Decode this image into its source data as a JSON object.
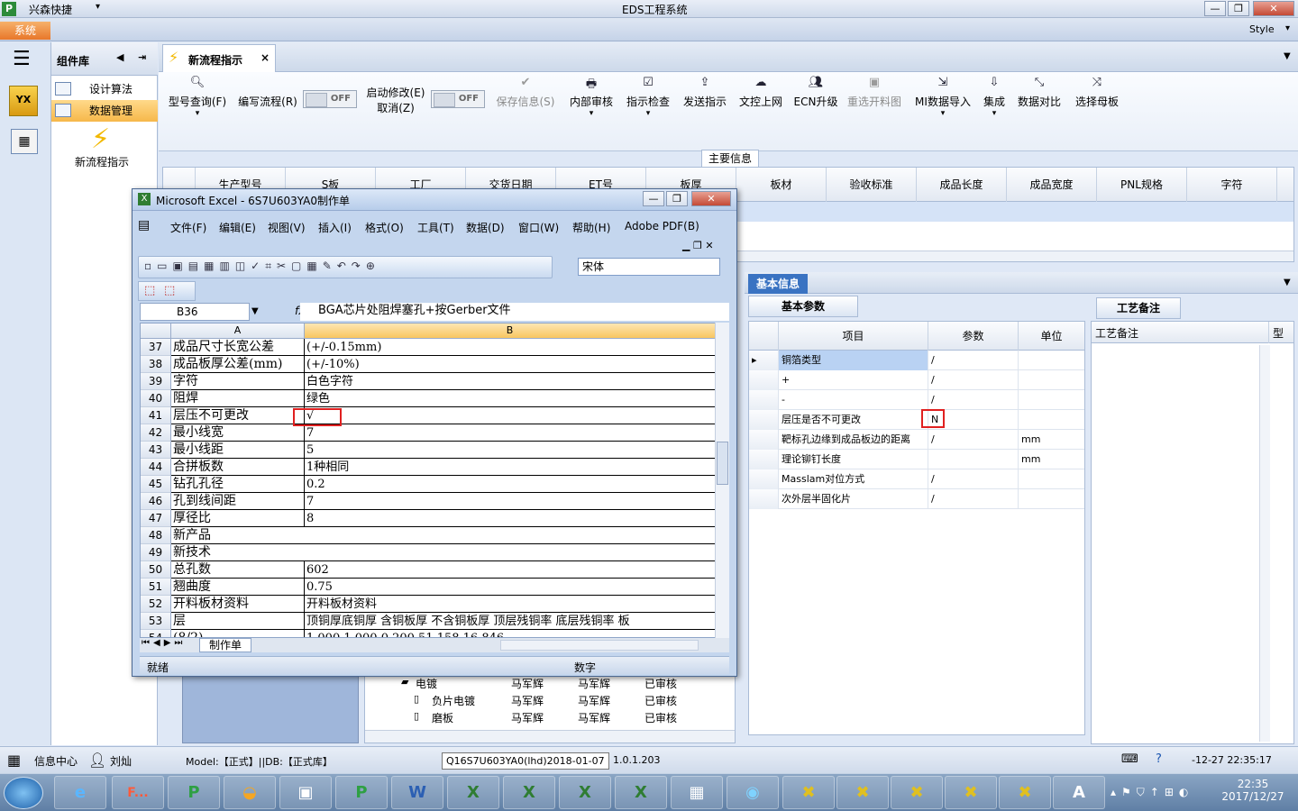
{
  "app": {
    "brand": "兴森快捷",
    "window_title": "EDS工程系统",
    "style_label": "Style",
    "system_tab": "系统"
  },
  "components": {
    "title": "组件库",
    "items": [
      {
        "label": "设计算法"
      },
      {
        "label": "数据管理"
      }
    ],
    "new_flow_label": "新流程指示"
  },
  "doc_tab": {
    "label": "新流程指示",
    "close": "×"
  },
  "toolbar": {
    "model_query": "型号查询(F)",
    "write_flow": "编写流程(R)",
    "toggle_off": "OFF",
    "start_modify": "启动修改(E)",
    "cancel": "取消(Z)",
    "save_info": "保存信息(S)",
    "internal_review": "内部审核",
    "instruction_check": "指示检查",
    "send_instruction": "发送指示",
    "upload": "文控上网",
    "ecn_upgrade": "ECN升级",
    "reselect_image": "重选开料图",
    "mi_import": "MI数据导入",
    "integrate": "集成",
    "data_compare": "数据对比",
    "select_mother": "选择母板"
  },
  "main_info": {
    "label": "主要信息",
    "columns": [
      "生产型号",
      "S板",
      "工厂",
      "交货日期",
      "ET号",
      "板厚",
      "板材",
      "验收标准",
      "成品长度",
      "成品宽度",
      "PNL规格",
      "字符"
    ]
  },
  "basic_info": {
    "label": "基本信息",
    "params_tab": "基本参数",
    "columns": [
      "项目",
      "参数",
      "单位"
    ],
    "rows": [
      {
        "item": "铜箔类型",
        "param": "/",
        "unit": ""
      },
      {
        "item": "+",
        "param": "/",
        "unit": ""
      },
      {
        "item": "-",
        "param": "/",
        "unit": ""
      },
      {
        "item": "层压是否不可更改",
        "param": "N",
        "unit": ""
      },
      {
        "item": "靶标孔边缘到成品板边的距离",
        "param": "/",
        "unit": "mm"
      },
      {
        "item": "理论铆钉长度",
        "param": "",
        "unit": "mm"
      },
      {
        "item": "Masslam对位方式",
        "param": "/",
        "unit": ""
      },
      {
        "item": "次外层半固化片",
        "param": "/",
        "unit": ""
      }
    ]
  },
  "craft_notes": {
    "tab": "工艺备注",
    "col1": "工艺备注",
    "col2": "型"
  },
  "tree": {
    "rows": [
      {
        "name": "电镀",
        "a": "马军辉",
        "b": "马军辉",
        "s": "已审核"
      },
      {
        "name": "负片电镀",
        "a": "马军辉",
        "b": "马军辉",
        "s": "已审核"
      },
      {
        "name": "磨板",
        "a": "马军辉",
        "b": "马军辉",
        "s": "已审核"
      }
    ]
  },
  "excel": {
    "title": "Microsoft Excel - 6S7U603YA0制作单",
    "menus": [
      "文件(F)",
      "编辑(E)",
      "视图(V)",
      "插入(I)",
      "格式(O)",
      "工具(T)",
      "数据(D)",
      "窗口(W)",
      "帮助(H)",
      "Adobe PDF(B)"
    ],
    "font": "宋体",
    "cell_ref": "B36",
    "formula": "BGA芯片处阻焊塞孔+按Gerber文件",
    "col_a": "A",
    "col_b": "B",
    "rows": [
      {
        "n": "37",
        "a": "成品尺寸长宽公差",
        "b": "(+/-0.15mm)"
      },
      {
        "n": "38",
        "a": "成品板厚公差(mm)",
        "b": "(+/-10%)"
      },
      {
        "n": "39",
        "a": "字符",
        "b": "白色字符"
      },
      {
        "n": "40",
        "a": "阻焊",
        "b": "绿色"
      },
      {
        "n": "41",
        "a": "层压不可更改",
        "b": "√"
      },
      {
        "n": "42",
        "a": "最小线宽",
        "b": "7"
      },
      {
        "n": "43",
        "a": "最小线距",
        "b": "5"
      },
      {
        "n": "44",
        "a": "合拼板数",
        "b": "1种相同"
      },
      {
        "n": "45",
        "a": "钻孔孔径",
        "b": "0.2"
      },
      {
        "n": "46",
        "a": "孔到线间距",
        "b": "7"
      },
      {
        "n": "47",
        "a": "厚径比",
        "b": "8"
      },
      {
        "n": "48",
        "a": "新产品",
        "b": ""
      },
      {
        "n": "49",
        "a": "新技术",
        "b": ""
      },
      {
        "n": "50",
        "a": "总孔数",
        "b": "602"
      },
      {
        "n": "51",
        "a": "翘曲度",
        "b": "0.75"
      },
      {
        "n": "52",
        "a": "开料板材资料",
        "b": "开料板材资料"
      },
      {
        "n": "53",
        "a": "层",
        "b": "顶铜厚底铜厚 含铜板厚 不含铜板厚 顶层残铜率 底层残铜率 板"
      },
      {
        "n": "54",
        "a": "(8/2)",
        "b": "1.000 1.000 0.200 51.158 16.846"
      }
    ],
    "sheet_tab": "制作单",
    "status_ready": "就绪",
    "status_num": "数字"
  },
  "status": {
    "info_center": "信息中心",
    "user": "刘灿",
    "model": "Model:【正式】||DB:【正式库】",
    "version": "1.0.1.203",
    "tooltip": "Q16S7U603YA0(lhd)2018-01-07",
    "datetime": "-12-27 22:35:17"
  },
  "taskbar": {
    "time": "22:35",
    "date": "2017/12/27",
    "f_label": "F..."
  }
}
